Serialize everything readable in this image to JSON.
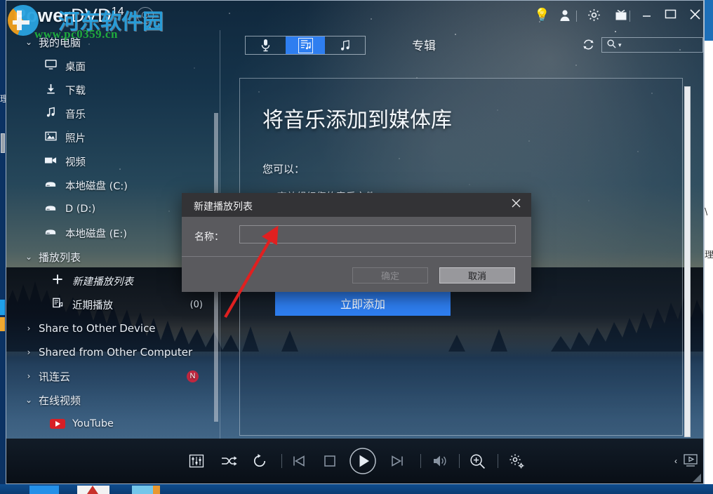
{
  "app": {
    "brand_prefix": "Power",
    "brand_suffix": "DVD",
    "brand_version": "14",
    "bell_icon": "bell-icon"
  },
  "watermark": {
    "site_name_cn": "河东软件园",
    "site_url": "www.pc0359.cn"
  },
  "titlebar": {
    "icons": [
      {
        "name": "bulb-icon",
        "glyph": "Ὂ1"
      },
      {
        "name": "user-icon",
        "glyph": "●"
      },
      {
        "name": "gear-icon",
        "glyph": "⚙"
      },
      {
        "name": "tv-icon",
        "glyph": "□"
      }
    ],
    "minimize_label": "—",
    "maximize_label": "□",
    "close_label": "✕"
  },
  "toolbar": {
    "types": [
      {
        "label": "Ἲ4",
        "name": "type-voice",
        "active": false
      },
      {
        "label": "♪",
        "name": "type-playlist",
        "active": true
      },
      {
        "label": "♫",
        "name": "type-music",
        "active": false
      }
    ],
    "view_title": "专辑",
    "refresh_label": "↻",
    "search_placeholder": "",
    "search_value": ""
  },
  "sidebar": {
    "groups": [
      {
        "label": "我的电脑",
        "expanded": true,
        "chevron": "⌄",
        "items": [
          {
            "label": "桌面",
            "icon": "monitor-icon",
            "glyph": "⬜"
          },
          {
            "label": "下载",
            "icon": "download-icon",
            "glyph": "↓"
          },
          {
            "label": "音乐",
            "icon": "music-note-icon",
            "glyph": "♪"
          },
          {
            "label": "照片",
            "icon": "photo-icon",
            "glyph": "ὛC"
          },
          {
            "label": "视频",
            "icon": "video-camera-icon",
            "glyph": "▶"
          },
          {
            "label": "本地磁盘 (C:)",
            "icon": "hard-disk-icon",
            "glyph": "▭"
          },
          {
            "label": "D (D:)",
            "icon": "hard-disk-icon",
            "glyph": "▭"
          },
          {
            "label": "本地磁盘 (E:)",
            "icon": "hard-disk-icon",
            "glyph": "▭"
          }
        ]
      },
      {
        "label": "播放列表",
        "expanded": true,
        "chevron": "⌄",
        "items": [
          {
            "label": "新建播放列表",
            "icon": "plus-icon",
            "glyph": "＋",
            "italic": true
          },
          {
            "label": "近期播放",
            "icon": "playlist-icon",
            "glyph": "☰",
            "count": "(0)"
          }
        ]
      },
      {
        "label": "Share to Other Device",
        "expanded": false,
        "chevron": "›",
        "items": []
      },
      {
        "label": "Shared from Other Computer",
        "expanded": false,
        "chevron": "›",
        "items": []
      },
      {
        "label": "讯连云",
        "expanded": false,
        "chevron": "›",
        "badge": "N",
        "items": []
      },
      {
        "label": "在线视频",
        "expanded": true,
        "chevron": "⌄",
        "items": [
          {
            "label": "YouTube",
            "icon": "youtube-icon",
            "glyph": ""
          }
        ]
      }
    ]
  },
  "main_panel": {
    "title": "将音乐添加到媒体库",
    "subtitle": "您可以：",
    "bullets": [
      "• 高效组织您的音乐文件"
    ],
    "add_button_label": "立即添加"
  },
  "dialog": {
    "title": "新建播放列表",
    "close_label": "✕",
    "field_label": "名称：",
    "name_value": "",
    "name_placeholder": "",
    "ok_label": "确定",
    "ok_enabled": false,
    "cancel_label": "取消",
    "cancel_enabled": true
  },
  "player_bar": {
    "controls": [
      {
        "name": "equalizer-button",
        "glyph": "▓"
      },
      {
        "name": "shuffle-button",
        "glyph": "⇄"
      },
      {
        "name": "repeat-button",
        "glyph": "↻"
      },
      {
        "name": "previous-button",
        "glyph": "⏮"
      },
      {
        "name": "stop-button",
        "glyph": "□"
      },
      {
        "name": "play-button",
        "glyph": "▶"
      },
      {
        "name": "next-button",
        "glyph": "⏭"
      },
      {
        "name": "volume-button",
        "glyph": "ὐA"
      },
      {
        "name": "zoom-button",
        "glyph": "⌕"
      },
      {
        "name": "settings-button",
        "glyph": "⚙"
      },
      {
        "name": "collapse-button",
        "glyph": "‹"
      },
      {
        "name": "screen-button",
        "glyph": "▷"
      }
    ]
  },
  "colors": {
    "accent_blue": "#2e7ef0",
    "dialog_bg": "#5a5a5e",
    "dialog_titlebar": "#333336",
    "badge_red": "#c0273f",
    "watermark_green": "#1faa3c",
    "watermark_blue": "#2aa3e0",
    "annotation_red": "#e02020"
  }
}
